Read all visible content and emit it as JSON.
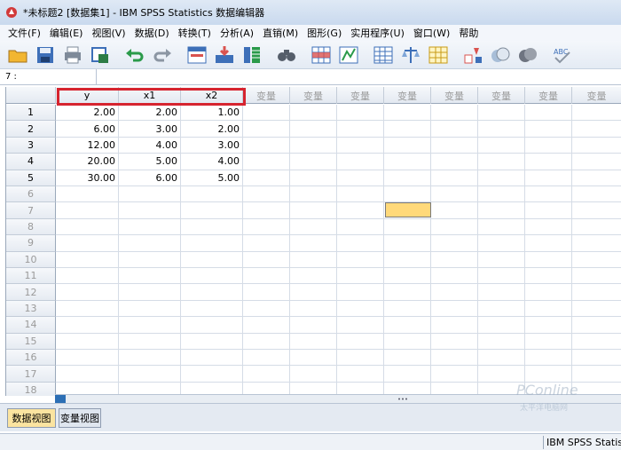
{
  "window": {
    "title": "*未标题2 [数据集1] - IBM SPSS Statistics 数据编辑器"
  },
  "menu": [
    "文件(F)",
    "编辑(E)",
    "视图(V)",
    "数据(D)",
    "转换(T)",
    "分析(A)",
    "直销(M)",
    "图形(G)",
    "实用程序(U)",
    "窗口(W)",
    "帮助"
  ],
  "toolbar": {
    "icons": [
      "open-icon",
      "save-icon",
      "print-icon",
      "dialog-recall-icon",
      "undo-icon",
      "redo-icon",
      "goto-case-icon",
      "goto-variable-icon",
      "variables-icon",
      "find-icon",
      "insert-cases-icon",
      "insert-variable-icon",
      "split-file-icon",
      "weight-cases-icon",
      "select-cases-icon",
      "value-labels-icon",
      "use-sets-icon",
      "show-sets-icon",
      "spelling-icon"
    ]
  },
  "cellref": {
    "label": "7 :"
  },
  "grid": {
    "columns": [
      "y",
      "x1",
      "x2",
      "变量",
      "变量",
      "变量",
      "变量",
      "变量",
      "变量",
      "变量",
      "变量"
    ],
    "rows": [
      [
        "1",
        "2.00",
        "2.00",
        "1.00"
      ],
      [
        "2",
        "6.00",
        "3.00",
        "2.00"
      ],
      [
        "3",
        "12.00",
        "4.00",
        "3.00"
      ],
      [
        "4",
        "20.00",
        "5.00",
        "4.00"
      ],
      [
        "5",
        "30.00",
        "6.00",
        "5.00"
      ],
      [
        "6",
        "",
        "",
        ""
      ],
      [
        "7",
        "",
        "",
        ""
      ],
      [
        "8",
        "",
        "",
        ""
      ],
      [
        "9",
        "",
        "",
        ""
      ],
      [
        "10",
        "",
        "",
        ""
      ],
      [
        "11",
        "",
        "",
        ""
      ],
      [
        "12",
        "",
        "",
        ""
      ],
      [
        "13",
        "",
        "",
        ""
      ],
      [
        "14",
        "",
        "",
        ""
      ],
      [
        "15",
        "",
        "",
        ""
      ],
      [
        "16",
        "",
        "",
        ""
      ],
      [
        "17",
        "",
        "",
        ""
      ],
      [
        "18",
        "",
        "",
        ""
      ]
    ]
  },
  "tabs": {
    "data_view": "数据视图",
    "variable_view": "变量视图"
  },
  "status": {
    "text": "IBM SPSS Statistic"
  },
  "watermark": {
    "logo": "PConline",
    "sub": "太平洋电脑网"
  },
  "colors": {
    "highlight_box": "#d6242f",
    "selected_cell": "#ffd97a",
    "active_tab": "#fbe4a0"
  }
}
